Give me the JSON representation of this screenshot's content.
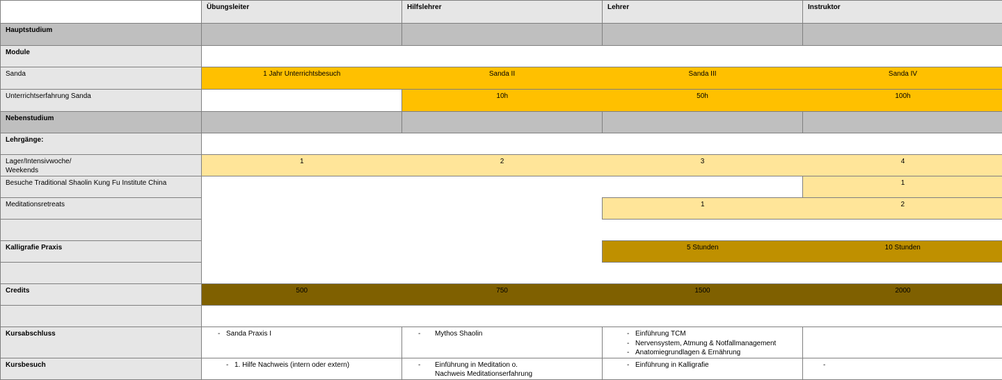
{
  "columns": [
    "Übungsleiter",
    "Hilfslehrer",
    "Lehrer",
    "Instruktor"
  ],
  "sections": {
    "hauptstudium": "Hauptstudium",
    "module": "Module",
    "nebenstudium": "Nebenstudium",
    "lehrgaenge": "Lehrgänge:",
    "credits": "Credits",
    "kursabschluss": "Kursabschluss",
    "kursbesuch": "Kursbesuch"
  },
  "rows": {
    "sanda": {
      "label": "Sanda",
      "values": [
        "1 Jahr Unterrichtsbesuch",
        "Sanda II",
        "Sanda III",
        "Sanda IV"
      ]
    },
    "unterricht": {
      "label": "Unterrichtserfahrung Sanda",
      "values": [
        "10h",
        "50h",
        "100h"
      ]
    },
    "lager": {
      "label_line1": "Lager/Intensivwoche/",
      "label_line2": "Weekends",
      "values": [
        "1",
        "2",
        "3",
        "4"
      ]
    },
    "china": {
      "label": "Besuche Traditional Shaolin Kung Fu Institute China",
      "values": [
        "1"
      ]
    },
    "meditation": {
      "label": "Meditationsretreats",
      "values": [
        "1",
        "2"
      ]
    },
    "kalligrafie": {
      "label": "Kalligrafie Praxis",
      "values": [
        "5 Stunden",
        "10 Stunden"
      ]
    },
    "credits": {
      "values": [
        "500",
        "750",
        "1500",
        "2000"
      ]
    }
  },
  "kursabschluss": {
    "uebungsleiter": [
      "Sanda Praxis I"
    ],
    "hilfslehrer": [
      "Mythos Shaolin"
    ],
    "lehrer": [
      "Einführung TCM",
      "Nervensystem, Atmung & Notfallmanagement",
      "Anatomiegrundlagen & Ernährung"
    ]
  },
  "kursbesuch": {
    "uebungsleiter": [
      "1. Hilfe Nachweis (intern oder extern)"
    ],
    "hilfslehrer_line1": "Einführung in Meditation o.",
    "hilfslehrer_line2": "Nachweis Meditationserfahrung",
    "lehrer": [
      "Einführung in Kalligrafie"
    ],
    "instruktor_dash": "-"
  },
  "dash": "-",
  "colors": {
    "label_bg": "#e6e6e6",
    "section_bg": "#bfbfbf",
    "orange": "#ffc000",
    "light_yellow": "#ffe599",
    "gold": "#bf9000",
    "brown": "#7f6000"
  }
}
